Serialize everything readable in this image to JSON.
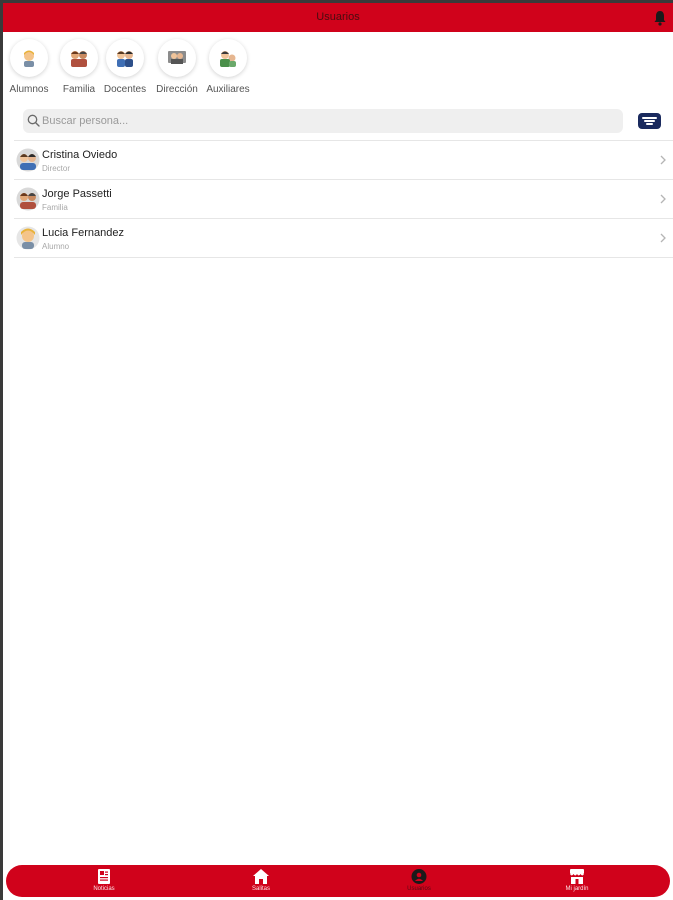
{
  "header": {
    "title": "Usuarios"
  },
  "categories": [
    {
      "label": "Alumnos"
    },
    {
      "label": "Familia"
    },
    {
      "label": "Docentes"
    },
    {
      "label": "Dirección"
    },
    {
      "label": "Auxiliares"
    }
  ],
  "search": {
    "placeholder": "Buscar persona...",
    "value": ""
  },
  "users": [
    {
      "name": "Cristina Oviedo",
      "role": "Director"
    },
    {
      "name": "Jorge Passetti",
      "role": "Familia"
    },
    {
      "name": "Lucia Fernandez",
      "role": "Alumno"
    }
  ],
  "tabs": [
    {
      "label": "Noticias",
      "icon": "newspaper-icon"
    },
    {
      "label": "Salitas",
      "icon": "home-icon"
    },
    {
      "label": "Usuarios",
      "icon": "users-icon"
    },
    {
      "label": "Mi jardín",
      "icon": "store-icon"
    }
  ],
  "colors": {
    "primary": "#d0021b",
    "filter": "#1a2a5e"
  }
}
